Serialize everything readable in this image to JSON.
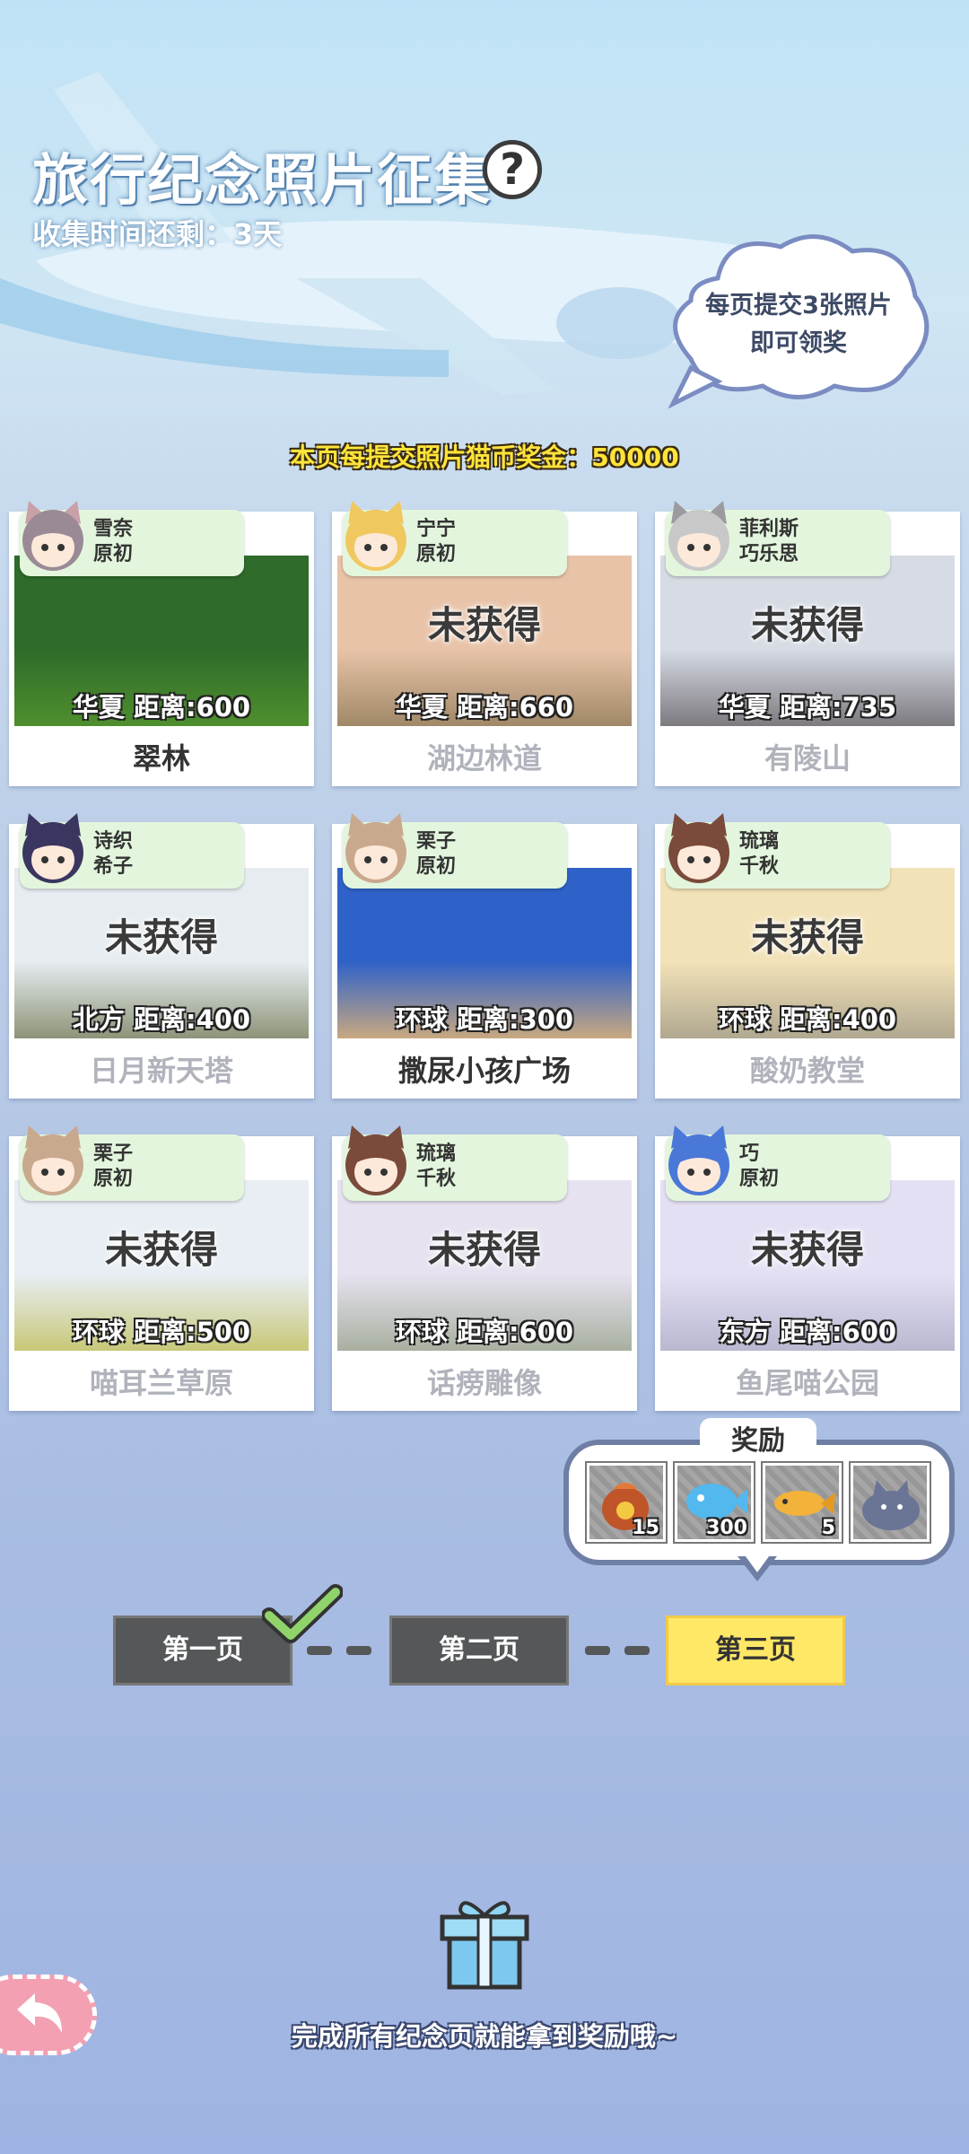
{
  "header": {
    "title": "旅行纪念照片征集",
    "help_label": "?",
    "time_left": "收集时间还剩：3天"
  },
  "tip_cloud": {
    "line1": "每页提交3张照片",
    "line2": "即可领奖"
  },
  "bonus_text": "本页每提交照片猫币奖金：50000",
  "cards": [
    {
      "char_line1": "雪奈",
      "char_line2": "原初",
      "status": "",
      "distance": "华夏  距离:600",
      "place": "翠林",
      "obtained": true,
      "hair": "#9a8a96",
      "ear": "#c8a0a8",
      "sky": "#2f6b2a",
      "ground": "#4f8f2e"
    },
    {
      "char_line1": "宁宁",
      "char_line2": "原初",
      "status": "未获得",
      "distance": "华夏  距离:660",
      "place": "湖边林道",
      "obtained": false,
      "hair": "#f0c860",
      "ear": "#f0c860",
      "sky": "#e8c3a8",
      "ground": "#a08868"
    },
    {
      "char_line1": "菲利斯",
      "char_line2": "巧乐思",
      "status": "未获得",
      "distance": "华夏  距离:735",
      "place": "有陵山",
      "obtained": false,
      "hair": "#c8c8c8",
      "ear": "#9a9aa0",
      "sky": "#d6dbe4",
      "ground": "#7d7a80"
    },
    {
      "char_line1": "诗织",
      "char_line2": "希子",
      "status": "未获得",
      "distance": "北方  距离:400",
      "place": "日月新天塔",
      "obtained": false,
      "hair": "#3a3660",
      "ear": "#3a3660",
      "sky": "#e6ecf0",
      "ground": "#8c9478"
    },
    {
      "char_line1": "栗子",
      "char_line2": "原初",
      "status": "",
      "distance": "环球  距离:300",
      "place": "撒尿小孩广场",
      "obtained": true,
      "hair": "#c9a98e",
      "ear": "#c9a98e",
      "sky": "#2f62c8",
      "ground": "#c8a880"
    },
    {
      "char_line1": "琉璃",
      "char_line2": "千秋",
      "status": "未获得",
      "distance": "环球  距离:400",
      "place": "酸奶教堂",
      "obtained": false,
      "hair": "#7a4a3a",
      "ear": "#7a4a3a",
      "sky": "#f2e2b8",
      "ground": "#b0a890"
    },
    {
      "char_line1": "栗子",
      "char_line2": "原初",
      "status": "未获得",
      "distance": "环球  距离:500",
      "place": "喵耳兰草原",
      "obtained": false,
      "hair": "#c9a98e",
      "ear": "#c9a98e",
      "sky": "#e8eef4",
      "ground": "#c8c878"
    },
    {
      "char_line1": "琉璃",
      "char_line2": "千秋",
      "status": "未获得",
      "distance": "环球  距离:600",
      "place": "话痨雕像",
      "obtained": false,
      "hair": "#7a4a3a",
      "ear": "#7a4a3a",
      "sky": "#e6e2f0",
      "ground": "#a8b0a0"
    },
    {
      "char_line1": "巧",
      "char_line2": "原初",
      "status": "未获得",
      "distance": "东方  距离:600",
      "place": "鱼尾喵公园",
      "obtained": false,
      "hair": "#4a78d8",
      "ear": "#4a78d8",
      "sky": "#e4e0f4",
      "ground": "#b8b8d0"
    }
  ],
  "reward": {
    "title": "奖励",
    "items": [
      {
        "icon": "coin-bag-icon",
        "count": "15"
      },
      {
        "icon": "blue-fish-icon",
        "count": "300"
      },
      {
        "icon": "golden-fish-icon",
        "count": "5"
      },
      {
        "icon": "cat-plush-icon",
        "count": ""
      }
    ]
  },
  "pages": [
    {
      "label": "第一页",
      "completed": true
    },
    {
      "label": "第二页",
      "completed": false
    },
    {
      "label": "第三页",
      "active": true
    }
  ],
  "footer_text": "完成所有纪念页就能拿到奖励哦~",
  "colors": {
    "accent_yellow": "#ffe866",
    "tag_green": "#e3f6dd",
    "page_gray": "#555758",
    "check_green": "#8fd36a"
  }
}
